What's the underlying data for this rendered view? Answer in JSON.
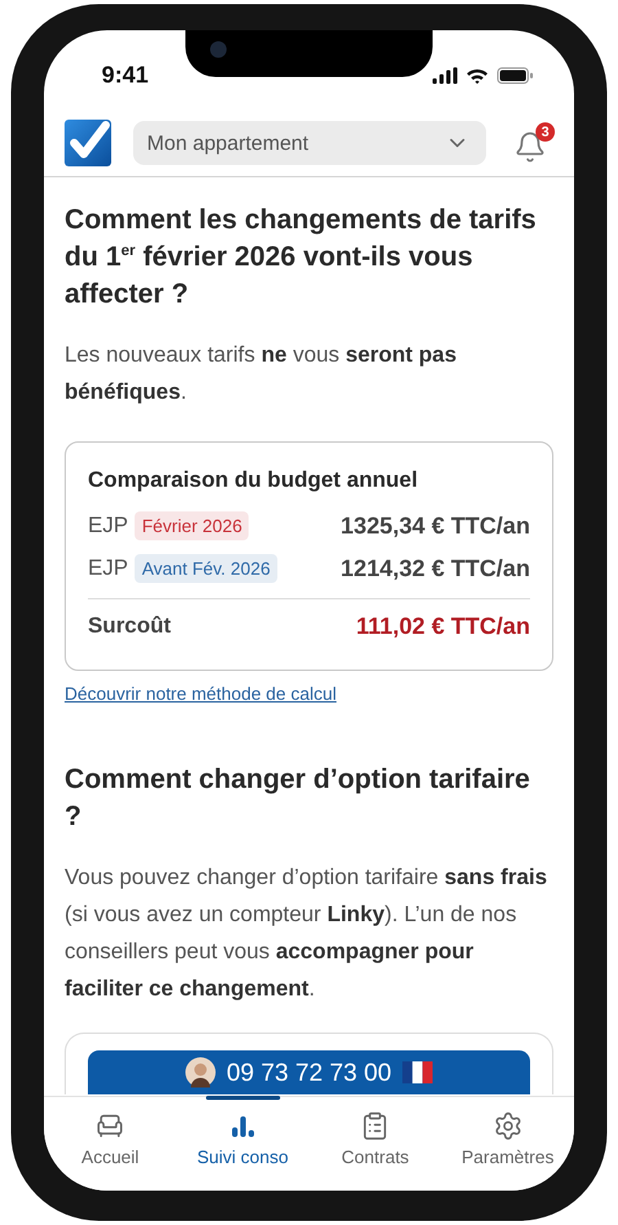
{
  "status_bar": {
    "time": "9:41"
  },
  "header": {
    "selector": {
      "value": "Mon appartement"
    },
    "notifications": {
      "count": "3"
    }
  },
  "impact_section": {
    "title": "Comment les changements de tarifs du 1$^{er}$ février 2026 vont-ils vous affecter ?",
    "paragraph": "Les nouveaux tarifs **ne** vous **seront pas bénéfiques**."
  },
  "comparison_card": {
    "title": "Comparaison du budget annuel",
    "rows": [
      {
        "label": "EJP",
        "tag": "Février 2026",
        "color": "#c8323a",
        "amount": "1325,34 € TTC/an"
      },
      {
        "label": "EJP",
        "tag": "Avant Fév. 2026",
        "color": "#2f6aa8",
        "amount": "1214,32 € TTC/an"
      }
    ],
    "total": {
      "label": "Surcoût",
      "amount": "111,02 € TTC/an"
    }
  },
  "method_link": "Découvrir notre méthode de calcul",
  "change_section": {
    "title": "Comment changer d’option tarifaire ?",
    "paragraph": "Vous pouvez changer d’option tarifaire **sans frais** (si vous avez un compteur **Linky**). L’un de nos conseillers peut vous **accompagner pour faciliter ce changement**."
  },
  "contact_button": {
    "phone": "09 73 72 73 00"
  },
  "bottom_nav": [
    {
      "label": "Accueil",
      "selected": false
    },
    {
      "label": "Suivi conso",
      "selected": true
    },
    {
      "label": "Contrats",
      "selected": false
    },
    {
      "label": "Paramètres",
      "selected": false
    }
  ]
}
